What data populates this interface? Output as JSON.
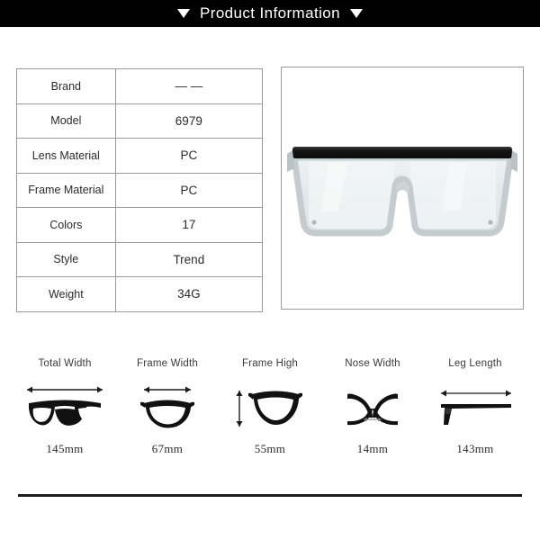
{
  "header": {
    "title": "Product Information",
    "left_triangle": "triangle-down-icon",
    "right_triangle": "triangle-down-icon",
    "background_color": "#000000",
    "text_color": "#ffffff"
  },
  "spec_table": {
    "rows": [
      {
        "label": "Brand",
        "value": "— —"
      },
      {
        "label": "Model",
        "value": "6979"
      },
      {
        "label": "Lens Material",
        "value": "PC"
      },
      {
        "label": "Frame Material",
        "value": "PC"
      },
      {
        "label": "Colors",
        "value": "17"
      },
      {
        "label": "Style",
        "value": "Trend"
      },
      {
        "label": "Weight",
        "value": "34G"
      }
    ],
    "border_color": "#9a9a9a"
  },
  "product_image": {
    "alt": "oversized flat-top square sunglasses with mirrored silver lenses",
    "frame_top_color": "#1a1a1a",
    "lens_color": "#e8eced",
    "frame_color": "#c8d0d2"
  },
  "measurements": [
    {
      "label": "Total Width",
      "value": "145mm",
      "icon": "full-glasses-icon",
      "arrow": "horizontal-double-arrow-icon"
    },
    {
      "label": "Frame Width",
      "value": "67mm",
      "icon": "single-lens-icon",
      "arrow": "horizontal-double-arrow-icon"
    },
    {
      "label": "Frame High",
      "value": "55mm",
      "icon": "single-lens-icon",
      "arrow": "vertical-double-arrow-icon"
    },
    {
      "label": "Nose Width",
      "value": "14mm",
      "icon": "nose-bridge-icon",
      "arrow": "horizontal-double-arrow-icon"
    },
    {
      "label": "Leg Length",
      "value": "143mm",
      "icon": "temple-arm-icon",
      "arrow": "horizontal-double-arrow-icon"
    }
  ],
  "divider": {
    "color": "#1c1c1c"
  }
}
